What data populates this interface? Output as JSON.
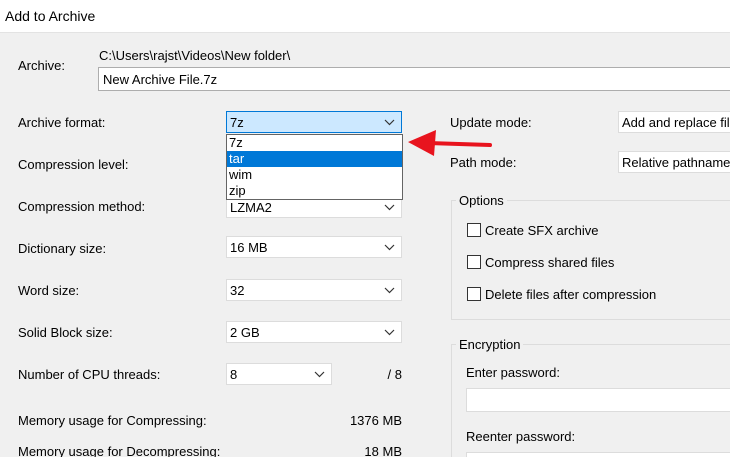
{
  "window": {
    "title": "Add to Archive"
  },
  "archive": {
    "label": "Archive:",
    "path": "C:\\Users\\rajst\\Videos\\New folder\\",
    "filename": "New Archive File.7z"
  },
  "left": {
    "archive_format": {
      "label": "Archive format:",
      "value": "7z"
    },
    "format_options": [
      "7z",
      "tar",
      "wim",
      "zip"
    ],
    "format_selected_index": 1,
    "compression_level": {
      "label": "Compression level:"
    },
    "compression_method": {
      "label": "Compression method:",
      "value": "LZMA2"
    },
    "dictionary_size": {
      "label": "Dictionary size:",
      "value": "16 MB"
    },
    "word_size": {
      "label": "Word size:",
      "value": "32"
    },
    "solid_block_size": {
      "label": "Solid Block size:",
      "value": "2 GB"
    },
    "cpu_threads": {
      "label": "Number of CPU threads:",
      "value": "8",
      "max": "/ 8"
    },
    "memory_compress": {
      "label": "Memory usage for Compressing:",
      "value": "1376 MB"
    },
    "memory_decompress": {
      "label": "Memory usage for Decompressing:",
      "value": "18 MB"
    }
  },
  "right": {
    "update_mode": {
      "label": "Update mode:",
      "value": "Add and replace files"
    },
    "path_mode": {
      "label": "Path mode:",
      "value": "Relative pathnames"
    },
    "options": {
      "title": "Options",
      "create_sfx": "Create SFX archive",
      "compress_shared": "Compress shared files",
      "delete_after": "Delete files after compression"
    },
    "encryption": {
      "title": "Encryption",
      "enter_password": "Enter password:",
      "reenter_password": "Reenter password:"
    }
  },
  "colors": {
    "accent": "#0078d7",
    "annotation_arrow": "#e8141e",
    "window_bg": "#f0f0f0"
  }
}
